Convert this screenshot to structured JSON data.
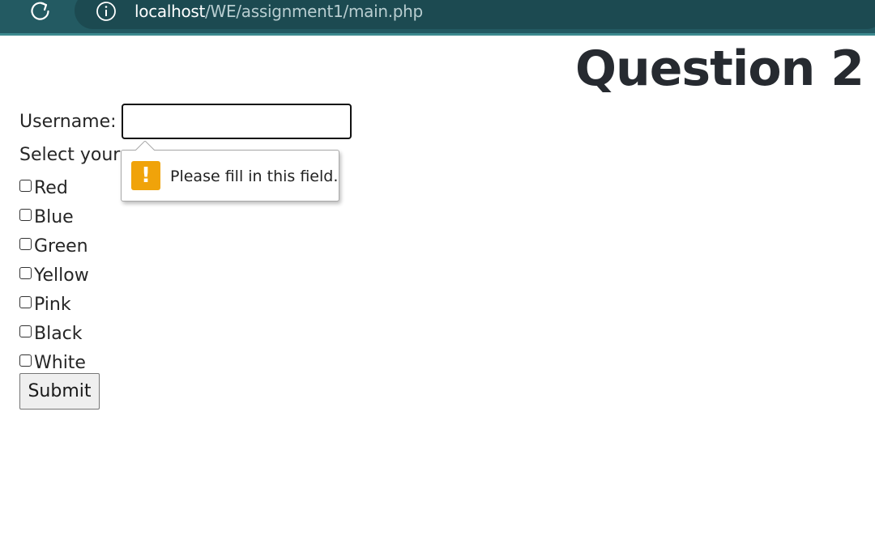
{
  "browser": {
    "url_host": "localhost",
    "url_path": "/WE/assignment1/main.php",
    "reload_icon": "reload-icon",
    "info_icon": "info-icon"
  },
  "page": {
    "title": "Question 2"
  },
  "form": {
    "username_label": "Username:",
    "username_value": "",
    "select_label": "Select your",
    "colors": [
      {
        "label": "Red",
        "checked": false
      },
      {
        "label": "Blue",
        "checked": false
      },
      {
        "label": "Green",
        "checked": false
      },
      {
        "label": "Yellow",
        "checked": false
      },
      {
        "label": "Pink",
        "checked": false
      },
      {
        "label": "Black",
        "checked": false
      },
      {
        "label": "White",
        "checked": false
      }
    ],
    "submit_label": "Submit"
  },
  "validation": {
    "message": "Please fill in this field.",
    "icon": "warning-icon",
    "icon_glyph": "!"
  },
  "colors": {
    "browser_bar": "#235a62",
    "warning": "#f0a30a"
  }
}
